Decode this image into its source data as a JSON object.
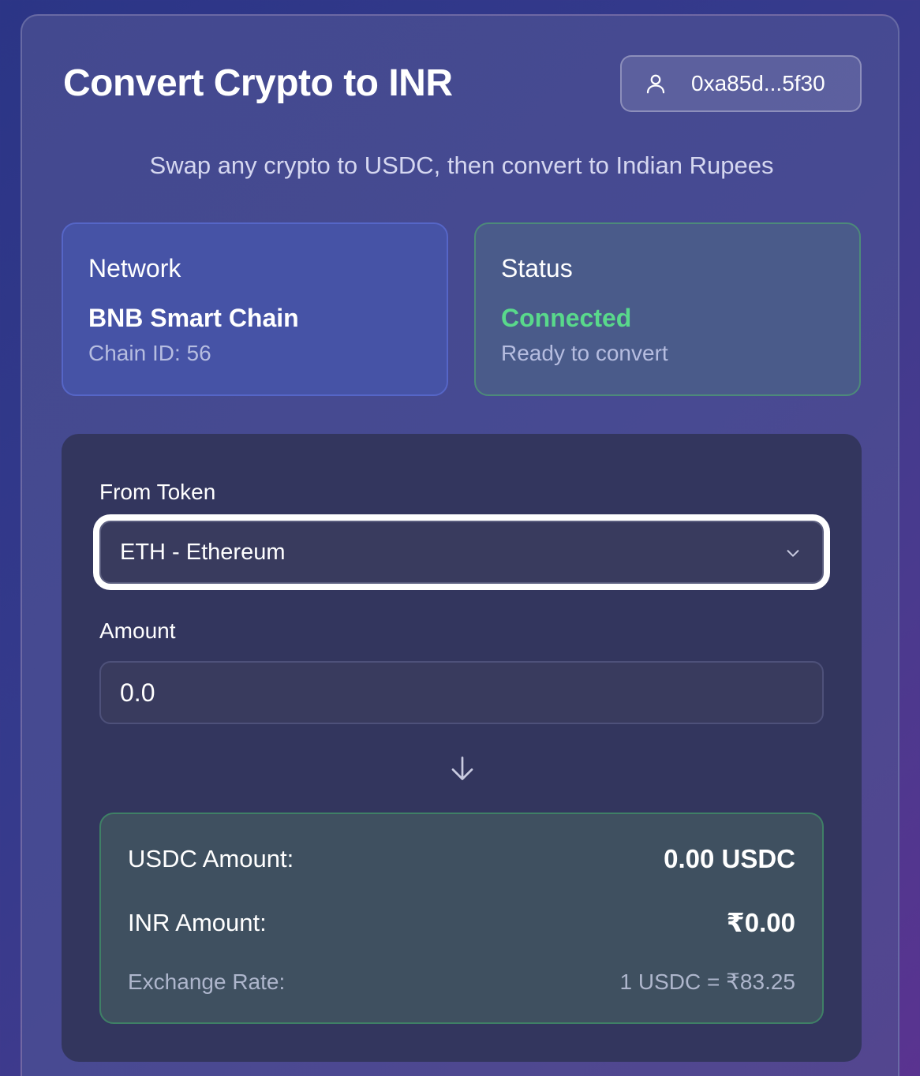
{
  "header": {
    "title": "Convert Crypto to INR",
    "wallet_address": "0xa85d...5f30",
    "subtitle": "Swap any crypto to USDC, then convert to Indian Rupees"
  },
  "network": {
    "label": "Network",
    "name": "BNB Smart Chain",
    "chain_id": "Chain ID: 56"
  },
  "status": {
    "label": "Status",
    "value": "Connected",
    "sub": "Ready to convert"
  },
  "form": {
    "from_token_label": "From Token",
    "from_token_selected": "ETH - Ethereum",
    "amount_label": "Amount",
    "amount_value": "0.0"
  },
  "result": {
    "usdc_label": "USDC Amount:",
    "usdc_value": "0.00 USDC",
    "inr_label": "INR Amount:",
    "inr_value": "₹0.00",
    "rate_label": "Exchange Rate:",
    "rate_value": "1 USDC = ₹83.25"
  },
  "colors": {
    "connected_green": "#59d98b",
    "focus_ring": "#ffffff"
  },
  "icons": [
    "user-icon",
    "chevron-down-icon",
    "arrow-down-icon"
  ]
}
